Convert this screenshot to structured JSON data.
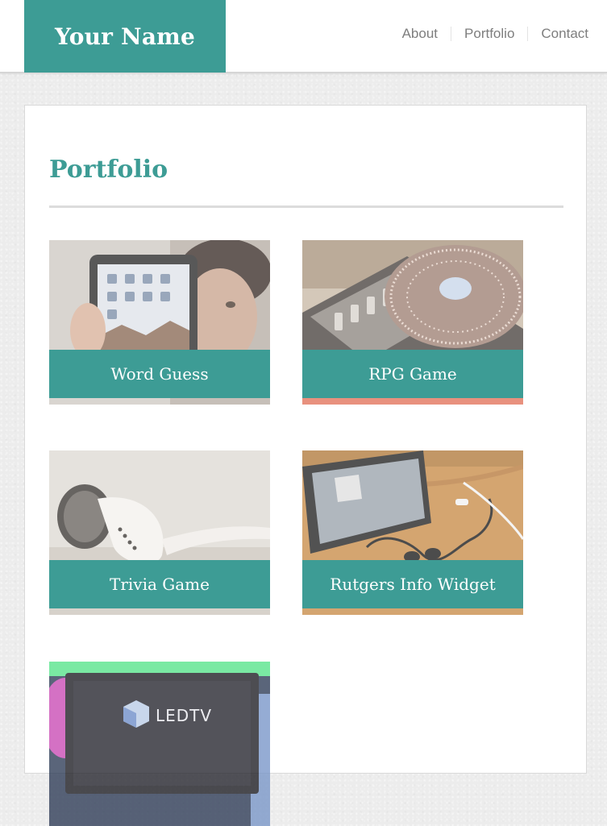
{
  "header": {
    "brand": "Your Name",
    "nav": [
      {
        "label": "About"
      },
      {
        "label": "Portfolio"
      },
      {
        "label": "Contact"
      }
    ]
  },
  "main": {
    "title": "Portfolio",
    "projects": [
      {
        "title": "Word Guess",
        "image_icon": "tablet-photo-icon"
      },
      {
        "title": "RPG Game",
        "image_icon": "turntable-photo-icon"
      },
      {
        "title": "Trivia Game",
        "image_icon": "earbuds-photo-icon"
      },
      {
        "title": "Rutgers Info Widget",
        "image_icon": "phone-earphones-photo-icon"
      },
      {
        "title": "",
        "image_icon": "led-tv-photo-icon",
        "photo_text": "LEDTV"
      }
    ]
  },
  "colors": {
    "accent": "#3d9c95",
    "nav_text": "#7e7e7e",
    "page_background": "#ececec"
  }
}
